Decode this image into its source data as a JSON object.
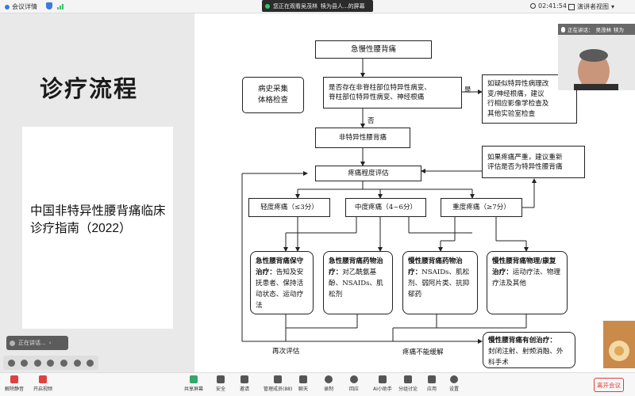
{
  "topbar": {
    "meeting_details": "会议详情",
    "sharing_status": "您正在观看吴茂林",
    "sharing_target": "犊为县人...的屏幕",
    "time": "02:41:54",
    "presenter_view": "演讲者视图"
  },
  "slide": {
    "title": "诊疗流程",
    "card_text": "中国非特异性腰背痛临床诊疗指南（2022）",
    "sticker_label": "正在讲话..."
  },
  "flowchart": {
    "top": "急慢性腰背痛",
    "history": "病史采集\n体格检查",
    "question": "是否存在非脊柱部位特异性病变、\n脊柱部位特异性病变、神经根痛",
    "yes": "是",
    "yes_result": "如疑似特异性病理改\n变/神经根痛，建议\n行相应影像学检查及\n其他实验室检查",
    "no": "否",
    "nonspecific": "非特异性腰背痛",
    "severe_note": "如果疼痛严重，建议重新\n评估是否为特异性腰背痛",
    "assessment": "疼痛程度评估",
    "mild": "轻度疼痛（≤3分）",
    "moderate": "中度疼痛（4~6分）",
    "severe": "重度疼痛（≥7分）",
    "t1_title": "急性腰背痛保守治疗：",
    "t1_body": "告知及安抚患者、保持活动状态、运动疗法",
    "t2_title": "急性腰背痛药物治疗：",
    "t2_body": "对乙酰氨基酚、NSAIDs、肌松剂",
    "t3_title": "慢性腰背痛药物治疗：",
    "t3_body": "NSAIDs、肌松剂、弱阿片类、抗抑郁药",
    "t4_title": "慢性腰背痛物理/康复治疗：",
    "t4_body": "运动疗法、物理疗法及其他",
    "reassess": "再次评估",
    "not_relieved": "疼痛不能缓解",
    "invasive_title": "慢性腰背痛有创治疗：",
    "invasive_body": "封闭注射、射频消融、外科手术"
  },
  "speaker": {
    "label": "正在讲话：",
    "name": "吴茂林",
    "extra": "犊为"
  },
  "toolbar": {
    "items": [
      "解除静音",
      "开启视频",
      "共享屏幕",
      "安全",
      "邀请",
      "管理成员(88)",
      "聊天",
      "录制",
      "回应",
      "AI小助手",
      "分组讨论",
      "应用",
      "设置"
    ],
    "leave": "离开会议"
  }
}
